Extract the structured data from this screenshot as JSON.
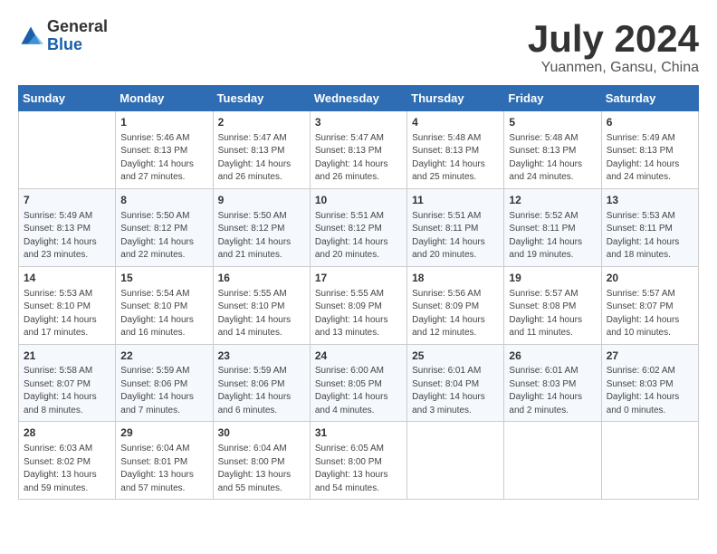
{
  "header": {
    "logo_general": "General",
    "logo_blue": "Blue",
    "title": "July 2024",
    "subtitle": "Yuanmen, Gansu, China"
  },
  "days_of_week": [
    "Sunday",
    "Monday",
    "Tuesday",
    "Wednesday",
    "Thursday",
    "Friday",
    "Saturday"
  ],
  "weeks": [
    [
      {
        "day": "",
        "content": ""
      },
      {
        "day": "1",
        "content": "Sunrise: 5:46 AM\nSunset: 8:13 PM\nDaylight: 14 hours\nand 27 minutes."
      },
      {
        "day": "2",
        "content": "Sunrise: 5:47 AM\nSunset: 8:13 PM\nDaylight: 14 hours\nand 26 minutes."
      },
      {
        "day": "3",
        "content": "Sunrise: 5:47 AM\nSunset: 8:13 PM\nDaylight: 14 hours\nand 26 minutes."
      },
      {
        "day": "4",
        "content": "Sunrise: 5:48 AM\nSunset: 8:13 PM\nDaylight: 14 hours\nand 25 minutes."
      },
      {
        "day": "5",
        "content": "Sunrise: 5:48 AM\nSunset: 8:13 PM\nDaylight: 14 hours\nand 24 minutes."
      },
      {
        "day": "6",
        "content": "Sunrise: 5:49 AM\nSunset: 8:13 PM\nDaylight: 14 hours\nand 24 minutes."
      }
    ],
    [
      {
        "day": "7",
        "content": "Sunrise: 5:49 AM\nSunset: 8:13 PM\nDaylight: 14 hours\nand 23 minutes."
      },
      {
        "day": "8",
        "content": "Sunrise: 5:50 AM\nSunset: 8:12 PM\nDaylight: 14 hours\nand 22 minutes."
      },
      {
        "day": "9",
        "content": "Sunrise: 5:50 AM\nSunset: 8:12 PM\nDaylight: 14 hours\nand 21 minutes."
      },
      {
        "day": "10",
        "content": "Sunrise: 5:51 AM\nSunset: 8:12 PM\nDaylight: 14 hours\nand 20 minutes."
      },
      {
        "day": "11",
        "content": "Sunrise: 5:51 AM\nSunset: 8:11 PM\nDaylight: 14 hours\nand 20 minutes."
      },
      {
        "day": "12",
        "content": "Sunrise: 5:52 AM\nSunset: 8:11 PM\nDaylight: 14 hours\nand 19 minutes."
      },
      {
        "day": "13",
        "content": "Sunrise: 5:53 AM\nSunset: 8:11 PM\nDaylight: 14 hours\nand 18 minutes."
      }
    ],
    [
      {
        "day": "14",
        "content": "Sunrise: 5:53 AM\nSunset: 8:10 PM\nDaylight: 14 hours\nand 17 minutes."
      },
      {
        "day": "15",
        "content": "Sunrise: 5:54 AM\nSunset: 8:10 PM\nDaylight: 14 hours\nand 16 minutes."
      },
      {
        "day": "16",
        "content": "Sunrise: 5:55 AM\nSunset: 8:10 PM\nDaylight: 14 hours\nand 14 minutes."
      },
      {
        "day": "17",
        "content": "Sunrise: 5:55 AM\nSunset: 8:09 PM\nDaylight: 14 hours\nand 13 minutes."
      },
      {
        "day": "18",
        "content": "Sunrise: 5:56 AM\nSunset: 8:09 PM\nDaylight: 14 hours\nand 12 minutes."
      },
      {
        "day": "19",
        "content": "Sunrise: 5:57 AM\nSunset: 8:08 PM\nDaylight: 14 hours\nand 11 minutes."
      },
      {
        "day": "20",
        "content": "Sunrise: 5:57 AM\nSunset: 8:07 PM\nDaylight: 14 hours\nand 10 minutes."
      }
    ],
    [
      {
        "day": "21",
        "content": "Sunrise: 5:58 AM\nSunset: 8:07 PM\nDaylight: 14 hours\nand 8 minutes."
      },
      {
        "day": "22",
        "content": "Sunrise: 5:59 AM\nSunset: 8:06 PM\nDaylight: 14 hours\nand 7 minutes."
      },
      {
        "day": "23",
        "content": "Sunrise: 5:59 AM\nSunset: 8:06 PM\nDaylight: 14 hours\nand 6 minutes."
      },
      {
        "day": "24",
        "content": "Sunrise: 6:00 AM\nSunset: 8:05 PM\nDaylight: 14 hours\nand 4 minutes."
      },
      {
        "day": "25",
        "content": "Sunrise: 6:01 AM\nSunset: 8:04 PM\nDaylight: 14 hours\nand 3 minutes."
      },
      {
        "day": "26",
        "content": "Sunrise: 6:01 AM\nSunset: 8:03 PM\nDaylight: 14 hours\nand 2 minutes."
      },
      {
        "day": "27",
        "content": "Sunrise: 6:02 AM\nSunset: 8:03 PM\nDaylight: 14 hours\nand 0 minutes."
      }
    ],
    [
      {
        "day": "28",
        "content": "Sunrise: 6:03 AM\nSunset: 8:02 PM\nDaylight: 13 hours\nand 59 minutes."
      },
      {
        "day": "29",
        "content": "Sunrise: 6:04 AM\nSunset: 8:01 PM\nDaylight: 13 hours\nand 57 minutes."
      },
      {
        "day": "30",
        "content": "Sunrise: 6:04 AM\nSunset: 8:00 PM\nDaylight: 13 hours\nand 55 minutes."
      },
      {
        "day": "31",
        "content": "Sunrise: 6:05 AM\nSunset: 8:00 PM\nDaylight: 13 hours\nand 54 minutes."
      },
      {
        "day": "",
        "content": ""
      },
      {
        "day": "",
        "content": ""
      },
      {
        "day": "",
        "content": ""
      }
    ]
  ]
}
